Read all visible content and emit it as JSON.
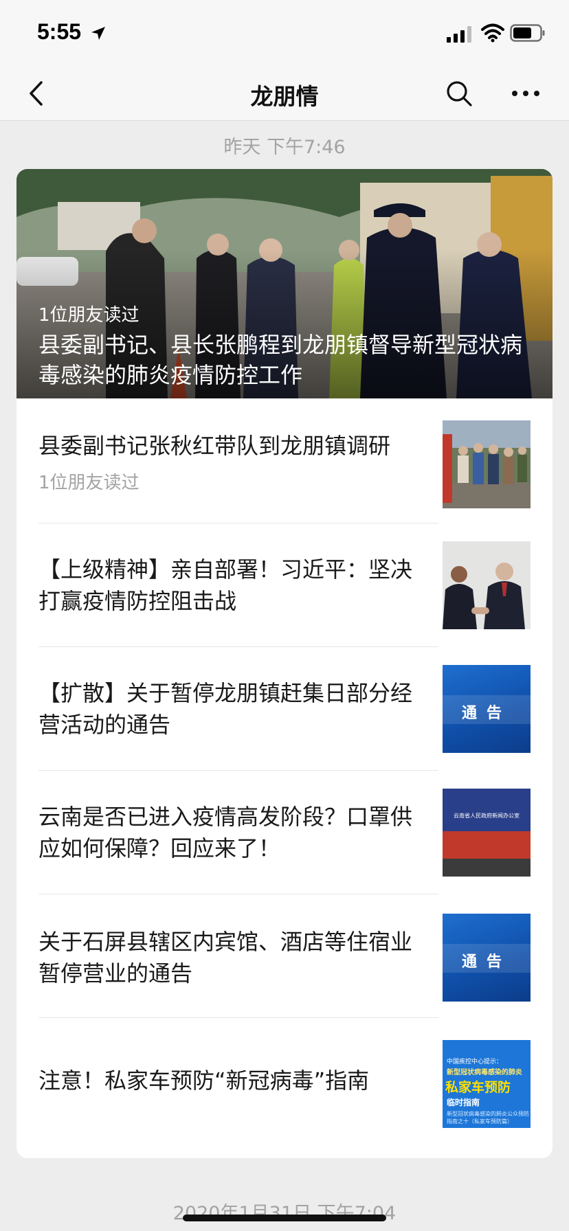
{
  "status_bar": {
    "time": "5:55"
  },
  "nav": {
    "title": "龙朋情"
  },
  "feed": {
    "timestamp_top": "昨天 下午7:46",
    "timestamp_bottom": "2020年1月31日 下午7:04",
    "hero": {
      "readers": "1位朋友读过",
      "title": "县委副书记、县长张鹏程到龙朋镇督导新型冠状病毒感染的肺炎疫情防控工作"
    },
    "articles": [
      {
        "title": "县委副书记张秋红带队到龙朋镇调研",
        "readers": "1位朋友读过",
        "thumb": "crowd-photo"
      },
      {
        "title": "【上级精神】亲自部署！习近平：坚决打赢疫情防控阻击战",
        "thumb": "handshake-photo"
      },
      {
        "title": "【扩散】关于暂停龙朋镇赶集日部分经营活动的通告",
        "thumb": "notice-graphic",
        "thumb_text": "通告"
      },
      {
        "title": "云南是否已进入疫情高发阶段？口罩供应如何保障？回应来了！",
        "thumb": "press-conference-photo",
        "thumb_text": "云南省人民政府新闻办公室"
      },
      {
        "title": "关于石屏县辖区内宾馆、酒店等住宿业暂停营业的通告",
        "thumb": "notice-graphic",
        "thumb_text": "通告"
      },
      {
        "title": "注意！私家车预防“新冠病毒”指南",
        "thumb": "car-guide-graphic",
        "thumb_lines": [
          "中国疾控中心提示：",
          "新型冠状病毒感染的肺炎",
          "私家车预防",
          "临时指南",
          "新型冠状病毒感染的肺炎公众预防指南之十（私家车预防篇）"
        ]
      }
    ]
  },
  "colors": {
    "background": "#ededed",
    "card": "#ffffff",
    "muted_text": "#a3a3a3",
    "notice_blue": "#1a5fc0"
  }
}
